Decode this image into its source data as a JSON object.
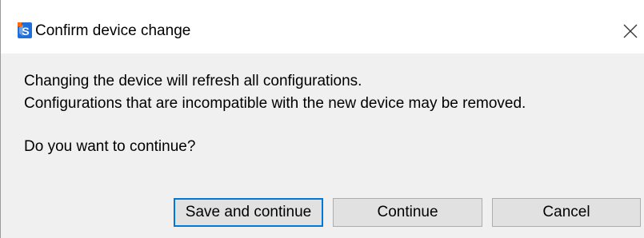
{
  "window": {
    "title": "Confirm device change",
    "icon": "app-logo-icon",
    "close_icon": "close-icon"
  },
  "message": {
    "line1": "Changing the device will refresh all configurations.",
    "line2": "Configurations that are incompatible with the new device may be removed.",
    "question": "Do you want to continue?"
  },
  "buttons": {
    "save_continue": "Save and continue",
    "continue": "Continue",
    "cancel": "Cancel"
  },
  "colors": {
    "titlebar_bg": "#ffffff",
    "dialog_bg": "#f0f0f0",
    "button_bg": "#e1e1e1",
    "focus_border": "#0078d7",
    "icon_blue": "#1e6fd9",
    "icon_orange": "#ff6a13"
  }
}
